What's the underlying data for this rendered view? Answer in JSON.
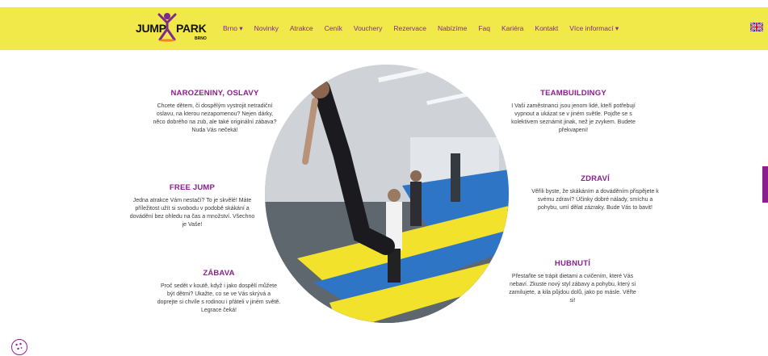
{
  "brand": {
    "logo_word1": "JUMP",
    "logo_word2": "PARK",
    "logo_sub": "BRNO"
  },
  "nav": {
    "items": [
      {
        "label": "Brno ▾"
      },
      {
        "label": "Novinky"
      },
      {
        "label": "Atrakce"
      },
      {
        "label": "Ceník"
      },
      {
        "label": "Vouchery"
      },
      {
        "label": "Rezervace"
      },
      {
        "label": "Nabízíme"
      },
      {
        "label": "Faq"
      },
      {
        "label": "Kariéra"
      },
      {
        "label": "Kontakt"
      },
      {
        "label": "Více informací ▾"
      }
    ],
    "language_flag": "uk-flag-icon"
  },
  "features": {
    "left": [
      {
        "title": "NAROZENINY, OSLAVY",
        "text": "Chcete dětem, či dospělým vystrojit netradiční oslavu, na kterou nezapomenou? Nejen dárky, něco dobrého na zub, ale také originální zábava? Nuda Vás nečeká!"
      },
      {
        "title": "FREE JUMP",
        "text": "Jedna atrakce Vám nestačí? To je skvělé! Máte příležitost užít si svobodu v podobě skákání a dovádění bez ohledu na čas a množství. Všechno je Vaše!"
      },
      {
        "title": "ZÁBAVA",
        "text": "Proč sedět v koutě, když i jako dospělí můžete být dětmi? Ukažte, co se ve Vás skrývá a doprejte si chvíle s rodinou i přáteli v jiném světě. Legrace čeká!"
      }
    ],
    "right": [
      {
        "title": "TEAMBUILDINGY",
        "text": "I Vaši zaměstnanci jsou jenom lidé, kteří potřebují vypnout a ukázat se v jiném světle. Pojďte se s kolektivem seznámit jinak, než je zvykem. Budete překvapeni!"
      },
      {
        "title": "ZDRAVÍ",
        "text": "Věřili byste, že skákáním a dováděním přispějete k svému zdraví? Účinky dobré nálady, smíchu a pohybu, umí dělat zázraky. Bude Vás to bavit!"
      },
      {
        "title": "HUBNUTÍ",
        "text": "Přestaňte se trápit dietami a cvičením, které Vás nebaví. Zkuste nový styl zábavy a pohybu, který si zamilujete, a kila půjdou dolů, jako po másle. Věřte si!"
      }
    ]
  },
  "colors": {
    "accent": "#8b1f8f",
    "navbar_bg": "#f1e84a",
    "nav_text": "#7b2a8e"
  },
  "icons": {
    "cookie": "cookie-icon"
  }
}
